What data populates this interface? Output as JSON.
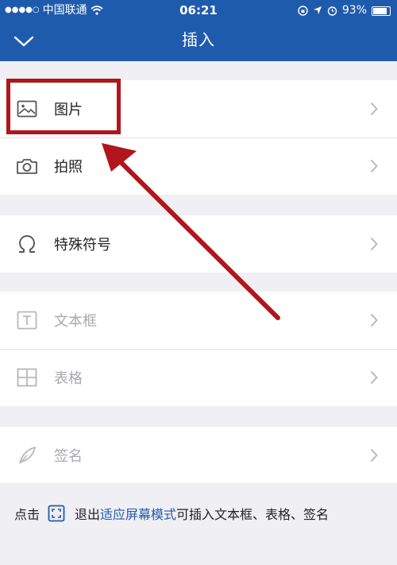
{
  "status_bar": {
    "signal": "●●●●○",
    "carrier": "中国联通",
    "time": "06:21",
    "battery": "93%",
    "battery_level": 0.93
  },
  "nav": {
    "title": "插入"
  },
  "groups": [
    {
      "items": [
        {
          "label": "图片",
          "icon": "image-icon",
          "enabled": true
        },
        {
          "label": "拍照",
          "icon": "camera-icon",
          "enabled": true
        }
      ]
    },
    {
      "items": [
        {
          "label": "特殊符号",
          "icon": "omega-icon",
          "enabled": true
        }
      ]
    },
    {
      "items": [
        {
          "label": "文本框",
          "icon": "text-box-icon",
          "enabled": false
        },
        {
          "label": "表格",
          "icon": "table-icon",
          "enabled": false
        }
      ]
    },
    {
      "items": [
        {
          "label": "签名",
          "icon": "signature-pen-icon",
          "enabled": false
        }
      ]
    }
  ],
  "footer": {
    "prefix": "点击",
    "middle": "退出",
    "accent": "适应屏幕模式",
    "suffix": "可插入文本框、表格、签名"
  },
  "colors": {
    "header_bg": "#1f5bad",
    "annotation_red": "#b0161c",
    "disabled_text": "#a9a9ad"
  }
}
